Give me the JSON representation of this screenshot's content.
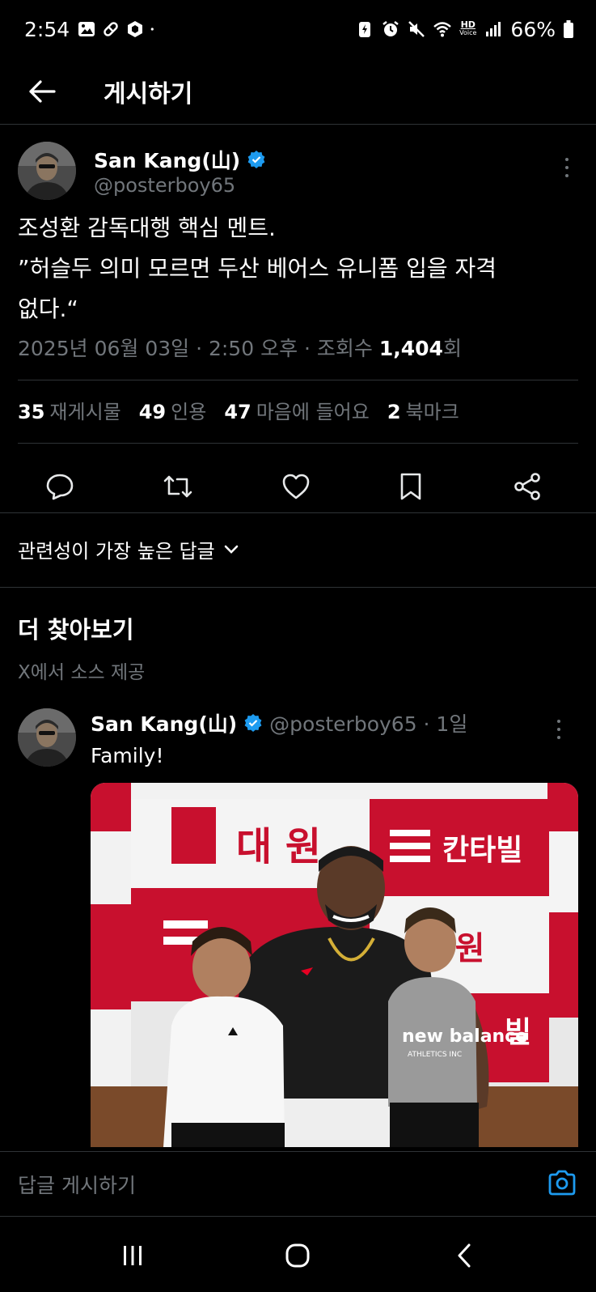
{
  "status_bar": {
    "time": "2:54",
    "battery": "66%",
    "network_badge_top": "HD",
    "network_badge_bottom": "Voice"
  },
  "topbar": {
    "title": "게시하기"
  },
  "post": {
    "author_name": "San Kang(山)",
    "author_handle": "@posterboy65",
    "text": "조성환 감독대행 핵심 멘트.\n”허슬두 의미 모르면 두산 베어스 유니폼 입을 자격\n없다.“",
    "meta_date": "2025년 06월 03일 · 2:50 오후 · 조회수 ",
    "meta_views": "1,404",
    "meta_views_suffix": "회",
    "stats": {
      "reposts_value": "35",
      "reposts_label": "재게시물",
      "quotes_value": "49",
      "quotes_label": "인용",
      "likes_value": "47",
      "likes_label": "마음에 들어요",
      "bookmarks_value": "2",
      "bookmarks_label": "북마크"
    }
  },
  "replies_sort": {
    "label": "관련성이 가장 높은 답글"
  },
  "discover": {
    "title": "더 찾아보기",
    "subtitle": "X에서 소스 제공"
  },
  "feed_item": {
    "author_name": "San Kang(山)",
    "author_handle": "@posterboy65 · 1일",
    "text": "Family!",
    "photo_signs": {
      "sign1": "대 원",
      "sign2": "칸타빌",
      "sign3": "대 원",
      "sign4": "빌",
      "shirt": "new balance",
      "shirt_sub": "ATHLETICS INC"
    }
  },
  "reply_bar": {
    "placeholder": "답글 게시하기"
  },
  "colors": {
    "background": "#000000",
    "verified": "#1d9bf0",
    "muted": "#71767b",
    "accent_camera": "#1d9bf0"
  }
}
